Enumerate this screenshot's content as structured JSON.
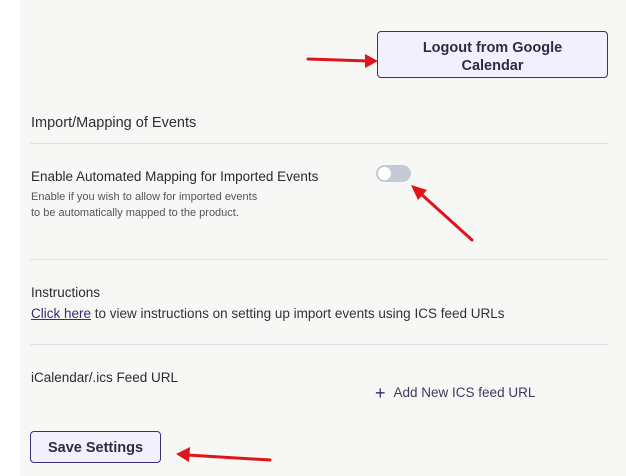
{
  "buttons": {
    "logout_google": "Logout from Google Calendar",
    "save_settings": "Save Settings"
  },
  "import_section": {
    "title": "Import/Mapping of Events",
    "auto_mapping_label": "Enable Automated Mapping for Imported Events",
    "auto_mapping_help": "Enable if you wish to allow for imported events to be automatically mapped to the product.",
    "auto_mapping_enabled": false
  },
  "instructions": {
    "title": "Instructions",
    "link_text": "Click here",
    "rest_text": " to view instructions on setting up import events using ICS feed URLs"
  },
  "feed": {
    "label": "iCalendar/.ics Feed URL",
    "add_label": "Add New ICS feed URL",
    "add_icon": "+"
  },
  "colors": {
    "accent": "#3f2d79",
    "button_bg": "#f3f0fd",
    "panel_bg": "#f7f7f6",
    "annotation_arrow": "#e0141b"
  }
}
